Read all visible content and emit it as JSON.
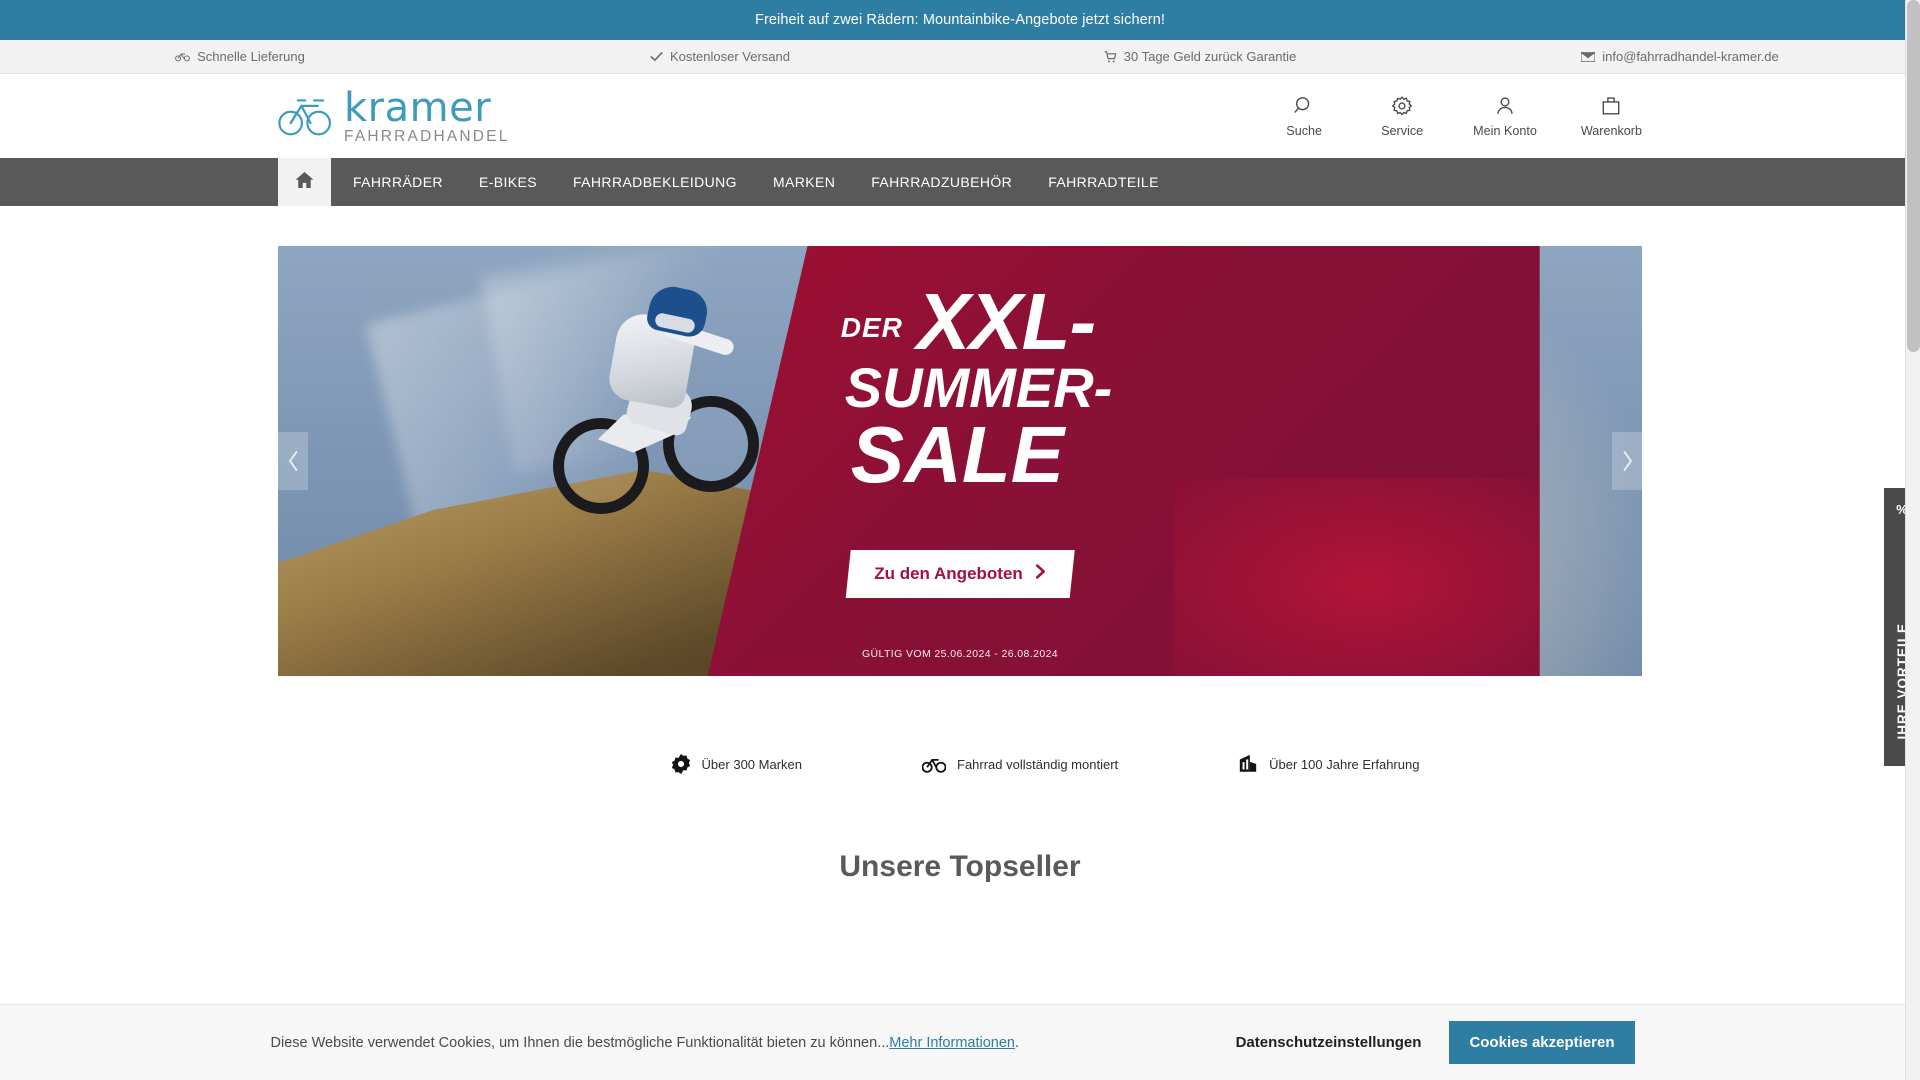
{
  "promo": {
    "text": "Freiheit auf zwei Rädern: Mountainbike-Angebote jetzt sichern!",
    "background": "#2e7da3"
  },
  "service_bar": {
    "items": [
      {
        "icon": "bicycle-icon",
        "label": "Schnelle Lieferung"
      },
      {
        "icon": "check-icon",
        "label": "Kostenloser Versand"
      },
      {
        "icon": "cart-icon",
        "label": "30 Tage Geld zurück Garantie"
      },
      {
        "icon": "envelope-icon",
        "label": "info@fahrradhandel-kramer.de"
      }
    ]
  },
  "header": {
    "logo": {
      "icon": "bicycle-logo-icon",
      "word": "kramer",
      "subtitle": "FAHRRADHANDEL",
      "color": "#3d9bbd"
    },
    "actions": [
      {
        "icon": "search-icon",
        "label": "Suche"
      },
      {
        "icon": "gear-icon",
        "label": "Service"
      },
      {
        "icon": "user-icon",
        "label": "Mein Konto"
      },
      {
        "icon": "bag-icon",
        "label": "Warenkorb"
      }
    ]
  },
  "nav": {
    "home_icon": "home-icon",
    "background": "#595959",
    "items": [
      "FAHRRÄDER",
      "E-BIKES",
      "FAHRRADBEKLEIDUNG",
      "MARKEN",
      "FAHRRADZUBEHÖR",
      "FAHRRADTEILE"
    ]
  },
  "hero": {
    "eyebrow": "DER",
    "line1": "XXL-",
    "line2": "SUMMER-",
    "line3": "SALE",
    "cta_label": "Zu den Angeboten",
    "cta_arrow": "chevron-right-icon",
    "validity": "GÜLTIG VOM 25.06.2024 - 26.08.2024",
    "panel_color": "#8a1036",
    "prev_icon": "chevron-left-icon",
    "next_icon": "chevron-right-icon"
  },
  "usps": [
    {
      "icon": "badge-icon",
      "label": "Über 300 Marken"
    },
    {
      "icon": "bicycle-icon",
      "label": "Fahrrad vollständig montiert"
    },
    {
      "icon": "experience-icon",
      "label": "Über 100 Jahre Erfahrung"
    }
  ],
  "sections": {
    "topseller_title": "Unsere Topseller"
  },
  "side_tab": {
    "icon": "percent-icon",
    "icon_glyph": "%",
    "label": "IHRE VORTEILE"
  },
  "cookie": {
    "text": "Diese Website verwendet Cookies, um Ihnen die bestmögliche Funktionalität bieten zu können...",
    "link": "Mehr Informationen",
    "suffix": ".",
    "settings_label": "Datenschutzeinstellungen",
    "accept_label": "Cookies akzeptieren",
    "accent": "#2e7da3"
  }
}
